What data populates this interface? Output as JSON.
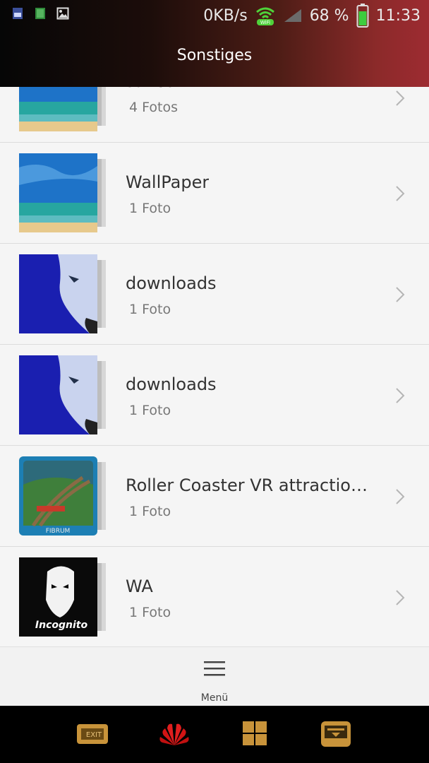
{
  "status_bar": {
    "speed": "0KB/s",
    "wifi_label": "WiFi",
    "battery_percent": "68 %",
    "time": "11:33",
    "icons": [
      "sim-icon",
      "app-icon",
      "image-icon",
      "wifi-icon",
      "signal-icon",
      "battery-icon"
    ]
  },
  "header": {
    "title": "Sonstiges"
  },
  "albums": [
    {
      "name": "saved",
      "count": "4 Fotos",
      "thumb": "beach"
    },
    {
      "name": "WallPaper",
      "count": "1 Foto",
      "thumb": "beach"
    },
    {
      "name": "downloads",
      "count": "1 Foto",
      "thumb": "wolf"
    },
    {
      "name": "downloads",
      "count": "1 Foto",
      "thumb": "wolf"
    },
    {
      "name": "Roller Coaster VR attraction…",
      "count": "1 Foto",
      "thumb": "coaster"
    },
    {
      "name": "WA",
      "count": "1 Foto",
      "thumb": "incognito"
    }
  ],
  "bottom_menu": {
    "label": "Menü"
  },
  "thumb_text": {
    "coaster_brand": "FIBRUM",
    "incognito": "Incognito"
  },
  "nav_bar": {
    "exit_label": "EXIT",
    "icons": [
      "exit-icon",
      "huawei-logo-icon",
      "grid-icon",
      "card-icon"
    ]
  },
  "colors": {
    "accent_gold": "#c8933a",
    "header_end": "#9d2b31"
  }
}
